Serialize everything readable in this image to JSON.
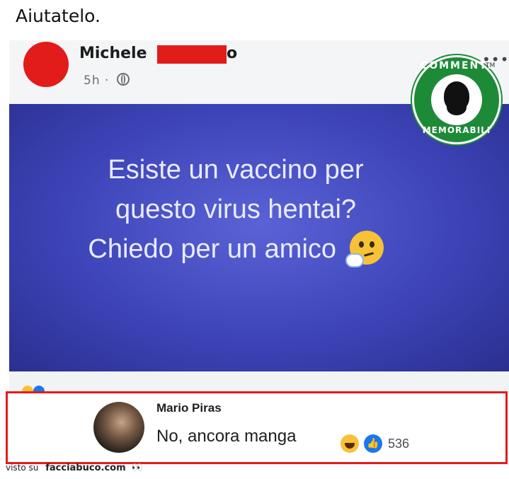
{
  "caption": "Aiutatelo.",
  "post": {
    "author_visible": "Michele ",
    "author_tail": "o",
    "time": "5h",
    "separator": "·",
    "menu": "•••",
    "image_text_lines": [
      "Esiste un vaccino per",
      "questo virus hentai?",
      "Chiedo per un amico"
    ],
    "image_emoji": "thinking-face",
    "logo": {
      "top": "COMMENTI",
      "bottom": "MEMORABILI",
      "tm": "TM"
    }
  },
  "comment": {
    "author": "Mario Piras",
    "text": "No, ancora manga",
    "reactions": [
      "haha",
      "like"
    ],
    "count": "536"
  },
  "footer": {
    "prefix": "visto su",
    "site": "facciabuco.com",
    "eyes": "👀"
  },
  "colors": {
    "redaction": "#e21b1b",
    "highlight_border": "#e31c1c",
    "image_bg": "#3d44b8",
    "like_blue": "#1877f2",
    "logo_green": "#1d8a37"
  }
}
